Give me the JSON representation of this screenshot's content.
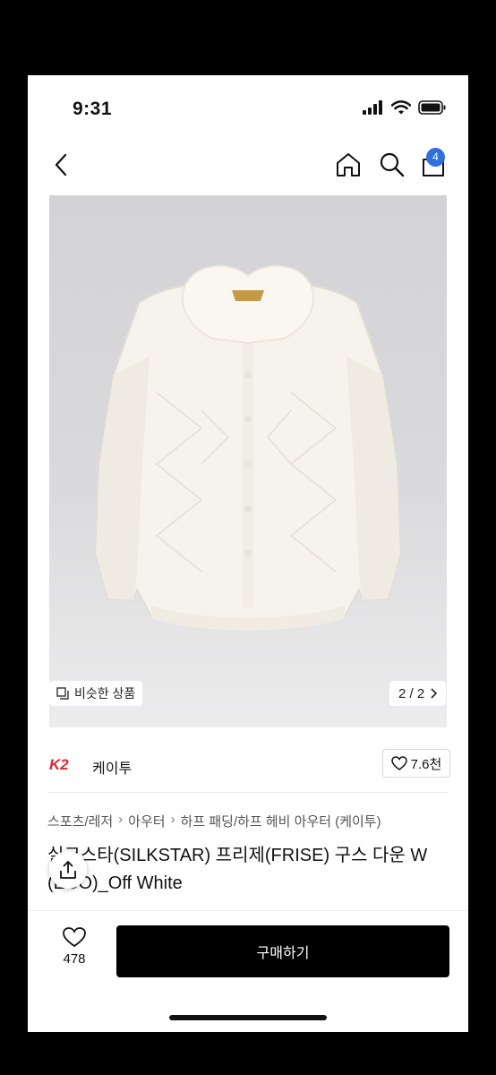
{
  "status_bar": {
    "time": "9:31"
  },
  "nav": {
    "cart_count": "4"
  },
  "hero": {
    "similar_label": "비슷한 상품",
    "counter": "2 / 2"
  },
  "brand": {
    "logo_text": "K2",
    "name": "케이투",
    "likes": "7.6천"
  },
  "breadcrumb": [
    "스포츠/레저",
    "아우터",
    "하프 패딩/하프 헤비 아우터 (케이투)"
  ],
  "product": {
    "title": "실크스타(SILKSTAR) 프리제(FRISE) 구스 다운 W (ECO)_Off White"
  },
  "bottom": {
    "wish_count": "478",
    "buy_label": "구매하기"
  },
  "colors": {
    "accent_badge": "#2f6fe0",
    "brand_red": "#e3262f"
  }
}
